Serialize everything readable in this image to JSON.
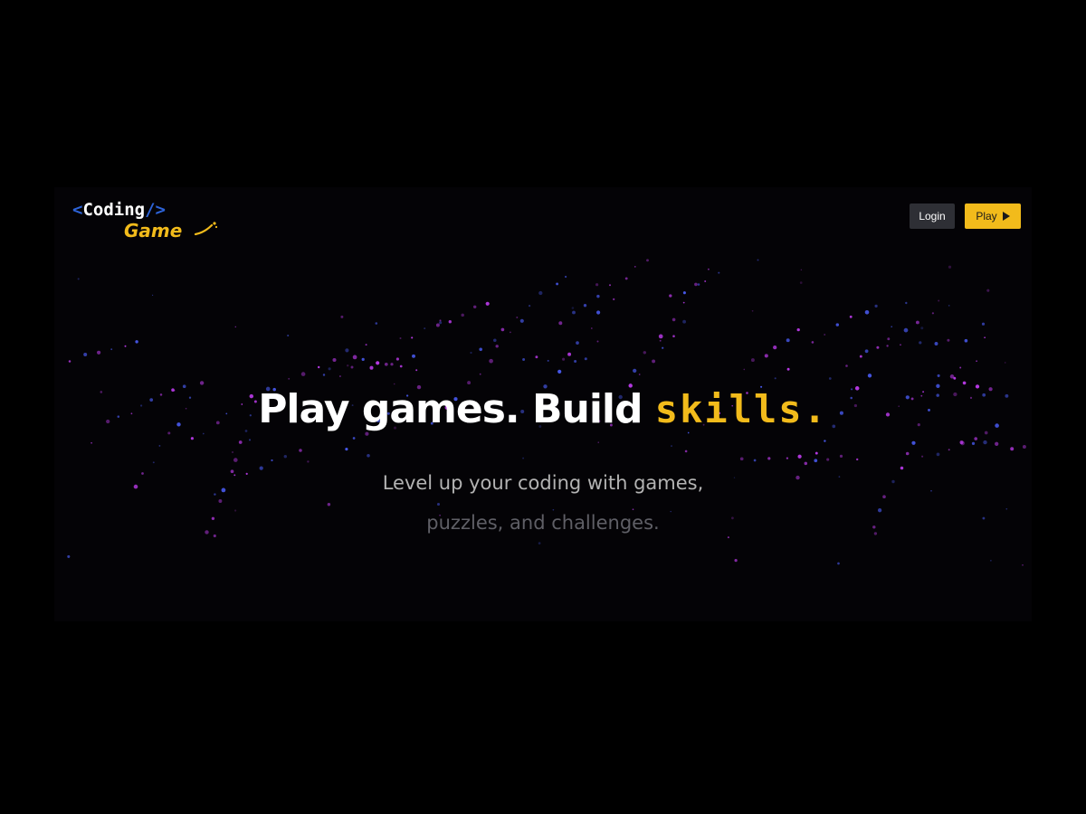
{
  "brand": {
    "logo_open_bracket": "<",
    "logo_word1": "Coding",
    "logo_close_bracket": "/>",
    "logo_word2": "Game",
    "colors": {
      "accent": "#f2bb1b",
      "bracket": "#2d63d8",
      "particle_purple": "#c03cf0",
      "particle_blue": "#4a5cf5"
    }
  },
  "nav": {
    "login_label": "Login",
    "play_label": "Play",
    "play_icon": "play-triangle-icon"
  },
  "hero": {
    "headline_main": "Play games. Build ",
    "headline_accent": "skills.",
    "subtitle_line1": "Level up your coding with games,",
    "subtitle_line2": "puzzles, and challenges."
  }
}
